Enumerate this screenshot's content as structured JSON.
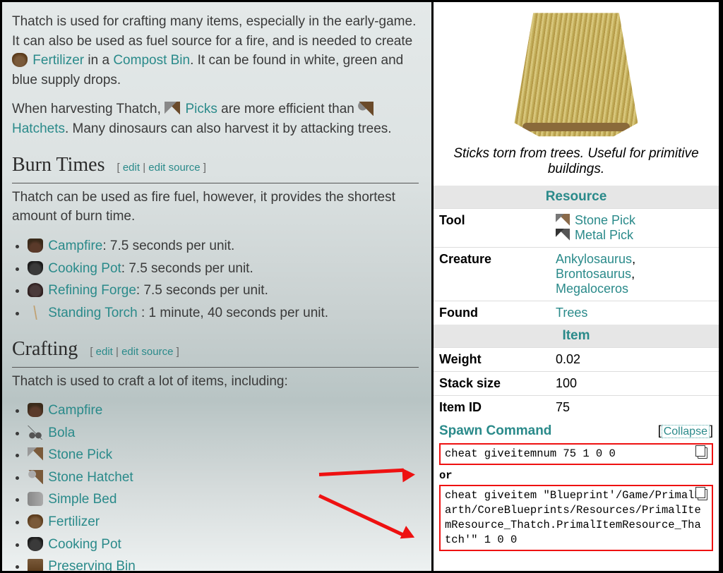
{
  "intro": {
    "p1a": "Thatch is used for crafting many items, especially in the early-game. It can also be used as fuel source for a fire, and is needed to create ",
    "fertilizer": "Fertilizer",
    "p1b": " in a ",
    "compost": "Compost Bin",
    "p1c": ". It can be found in white, green and blue supply drops.",
    "p2a": "When harvesting Thatch, ",
    "picks": "Picks",
    "p2b": " are more efficient than ",
    "hatchets": "Hatchets",
    "p2c": ". Many dinosaurs can also harvest it by attacking trees."
  },
  "sections": {
    "burn_title": "Burn Times",
    "craft_title": "Crafting",
    "edit": "edit",
    "editsrc": "edit source"
  },
  "burn": {
    "intro": "Thatch can be used as fire fuel, however, it provides the shortest amount of burn time.",
    "items": [
      {
        "name": "Campfire",
        "suffix": ": 7.5 seconds per unit."
      },
      {
        "name": "Cooking Pot",
        "suffix": ": 7.5 seconds per unit."
      },
      {
        "name": "Refining Forge",
        "suffix": ": 7.5 seconds per unit."
      },
      {
        "name": "Standing Torch",
        "suffix": " : 1 minute, 40 seconds per unit."
      }
    ]
  },
  "craft": {
    "intro": "Thatch is used to craft a lot of items, including:",
    "items": [
      "Campfire",
      "Bola",
      "Stone Pick",
      "Stone Hatchet",
      "Simple Bed",
      "Fertilizer",
      "Cooking Pot",
      "Preserving Bin"
    ]
  },
  "infobox": {
    "caption": "Sticks torn from trees. Useful for primitive buildings.",
    "hdr_resource": "Resource",
    "hdr_item": "Item",
    "rows": {
      "tool_k": "Tool",
      "tool_v1": "Stone Pick",
      "tool_v2": "Metal Pick",
      "creature_k": "Creature",
      "creature_v1": "Ankylosaurus",
      "creature_v2": "Brontosaurus",
      "creature_v3": "Megaloceros",
      "found_k": "Found",
      "found_v": "Trees",
      "weight_k": "Weight",
      "weight_v": "0.02",
      "stack_k": "Stack size",
      "stack_v": "100",
      "id_k": "Item ID",
      "id_v": "75"
    },
    "spawn_label": "Spawn Command",
    "collapse": "Collapse",
    "cmd1": "cheat giveitemnum 75 1 0 0",
    "or": "or",
    "cmd2": "cheat giveitem \"Blueprint'/Game/PrimalEarth/CoreBlueprints/Resources/PrimalItemResource_Thatch.PrimalItemResource_Thatch'\" 1 0 0"
  }
}
